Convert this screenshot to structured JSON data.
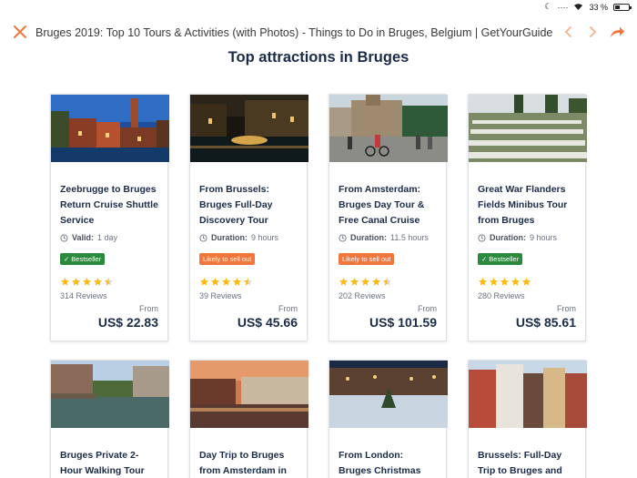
{
  "status_bar": {
    "battery": "33 %"
  },
  "header": {
    "title": "Bruges 2019: Top 10 Tours & Activities (with Photos) - Things to Do in Bruges, Belgium | GetYourGuide"
  },
  "section": {
    "title": "Top attractions in Bruges"
  },
  "colors": {
    "accent": "#f0763c",
    "bestseller": "#2b8a3e",
    "star": "#fdb813",
    "text": "#1a2b49"
  },
  "cards": [
    {
      "title": "Zeebrugge to Bruges Return Cruise Shuttle Service",
      "info_label": "Valid:",
      "info_value": "1 day",
      "badge": "Bestseller",
      "badge_type": "green",
      "rating": 4.5,
      "reviews": "314 Reviews",
      "from": "From",
      "price": "US$ 22.83"
    },
    {
      "title": "From Brussels: Bruges Full-Day Discovery Tour",
      "info_label": "Duration:",
      "info_value": "9 hours",
      "badge": "Likely to sell out",
      "badge_type": "orange",
      "rating": 4.5,
      "reviews": "39 Reviews",
      "from": "From",
      "price": "US$ 45.66"
    },
    {
      "title": "From Amsterdam: Bruges Day Tour & Free Canal Cruise",
      "info_label": "Duration:",
      "info_value": "11.5 hours",
      "badge": "Likely to sell out",
      "badge_type": "orange",
      "rating": 4.5,
      "reviews": "202 Reviews",
      "from": "From",
      "price": "US$ 101.59"
    },
    {
      "title": "Great War Flanders Fields Minibus Tour from Bruges",
      "info_label": "Duration:",
      "info_value": "9 hours",
      "badge": "Bestseller",
      "badge_type": "green",
      "rating": 5,
      "reviews": "280 Reviews",
      "from": "From",
      "price": "US$ 85.61"
    },
    {
      "title": "Bruges Private 2-Hour Walking Tour"
    },
    {
      "title": "Day Trip to Bruges from Amsterdam in"
    },
    {
      "title": "From London: Bruges Christmas Markets"
    },
    {
      "title": "Brussels: Full-Day Trip to Bruges and Ghent"
    }
  ]
}
